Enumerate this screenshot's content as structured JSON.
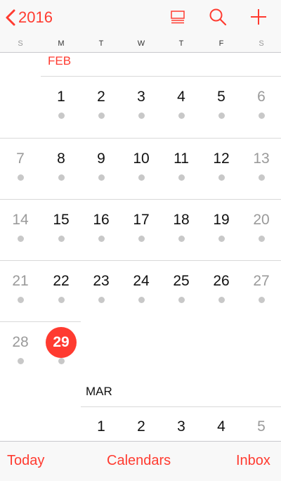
{
  "navbar": {
    "back_label": "2016",
    "icons": [
      "chevron-left-icon",
      "list-view-icon",
      "search-icon",
      "add-icon"
    ],
    "accent": "#ff3b30"
  },
  "weekdays": [
    "S",
    "M",
    "T",
    "W",
    "T",
    "F",
    "S"
  ],
  "months": [
    {
      "label": "FEB",
      "label_color": "#ff3b30",
      "weeks": [
        [
          "",
          "1",
          "2",
          "3",
          "4",
          "5",
          "6"
        ],
        [
          "7",
          "8",
          "9",
          "10",
          "11",
          "12",
          "13"
        ],
        [
          "14",
          "15",
          "16",
          "17",
          "18",
          "19",
          "20"
        ],
        [
          "21",
          "22",
          "23",
          "24",
          "25",
          "26",
          "27"
        ],
        [
          "28",
          "29",
          "",
          "",
          "",
          "",
          ""
        ]
      ],
      "today": "29"
    },
    {
      "label": "MAR",
      "label_color": "#111111",
      "weeks": [
        [
          "",
          "1",
          "2",
          "3",
          "4",
          "5"
        ]
      ]
    }
  ],
  "toolbar": {
    "today_label": "Today",
    "calendars_label": "Calendars",
    "inbox_label": "Inbox"
  }
}
